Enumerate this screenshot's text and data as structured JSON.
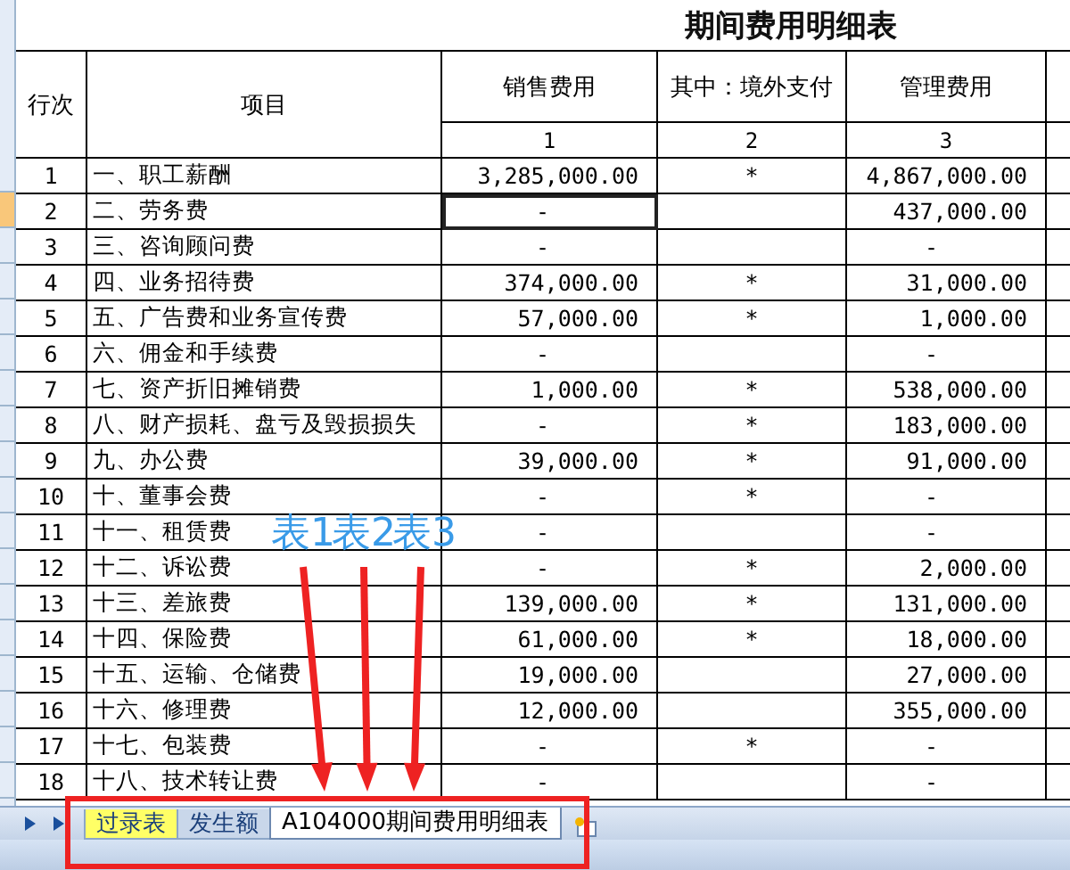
{
  "title": "期间费用明细表",
  "columns": [
    {
      "label": "行次"
    },
    {
      "label": "项目"
    },
    {
      "label": "销售费用",
      "number": "1"
    },
    {
      "label": "其中：境外支付",
      "number": "2"
    },
    {
      "label": "管理费用",
      "number": "3"
    }
  ],
  "rows": [
    {
      "no": "1",
      "item": "一、职工薪酬",
      "sales": "3,285,000.00",
      "overseas": "*",
      "admin": "4,867,000.00",
      "selected": false
    },
    {
      "no": "2",
      "item": "二、劳务费",
      "sales": "-",
      "admin": "437,000.00",
      "selected": true
    },
    {
      "no": "3",
      "item": "三、咨询顾问费",
      "sales": "-",
      "admin": "-",
      "selected": false
    },
    {
      "no": "4",
      "item": "四、业务招待费",
      "sales": "374,000.00",
      "overseas": "*",
      "admin": "31,000.00",
      "selected": false
    },
    {
      "no": "5",
      "item": "五、广告费和业务宣传费",
      "sales": "57,000.00",
      "overseas": "*",
      "admin": "1,000.00",
      "selected": false
    },
    {
      "no": "6",
      "item": "六、佣金和手续费",
      "sales": "-",
      "admin": "-",
      "selected": false
    },
    {
      "no": "7",
      "item": "七、资产折旧摊销费",
      "sales": "1,000.00",
      "overseas": "*",
      "admin": "538,000.00",
      "selected": false
    },
    {
      "no": "8",
      "item": "八、财产损耗、盘亏及毁损损失",
      "sales": "-",
      "overseas": "*",
      "admin": "183,000.00",
      "selected": false
    },
    {
      "no": "9",
      "item": "九、办公费",
      "sales": "39,000.00",
      "overseas": "*",
      "admin": "91,000.00",
      "selected": false
    },
    {
      "no": "10",
      "item": "十、董事会费",
      "sales": "-",
      "overseas": "*",
      "admin": "-",
      "selected": false
    },
    {
      "no": "11",
      "item": "十一、租赁费",
      "sales": "-",
      "admin": "-",
      "selected": false
    },
    {
      "no": "12",
      "item": "十二、诉讼费",
      "sales": "-",
      "overseas": "*",
      "admin": "2,000.00",
      "selected": false
    },
    {
      "no": "13",
      "item": "十三、差旅费",
      "sales": "139,000.00",
      "overseas": "*",
      "admin": "131,000.00",
      "selected": false
    },
    {
      "no": "14",
      "item": "十四、保险费",
      "sales": "61,000.00",
      "overseas": "*",
      "admin": "18,000.00",
      "selected": false
    },
    {
      "no": "15",
      "item": "十五、运输、仓储费",
      "sales": "19,000.00",
      "admin": "27,000.00",
      "selected": false
    },
    {
      "no": "16",
      "item": "十六、修理费",
      "sales": "12,000.00",
      "admin": "355,000.00",
      "selected": false
    },
    {
      "no": "17",
      "item": "十七、包装费",
      "sales": "-",
      "overseas": "*",
      "admin": "-",
      "selected": false
    },
    {
      "no": "18",
      "item": "十八、技术转让费",
      "sales": "-",
      "admin": "-",
      "selected": false
    }
  ],
  "sheet_tabs": [
    {
      "label": "过录表",
      "selected": false,
      "color": "#ffff66"
    },
    {
      "label": "发生额",
      "selected": false,
      "color": "#c9d7ea"
    },
    {
      "label": "A104000期间费用明细表",
      "selected": true,
      "color": "#ffffff"
    }
  ],
  "annotations": [
    {
      "label": "表1"
    },
    {
      "label": "表2"
    },
    {
      "label": "表3"
    }
  ]
}
